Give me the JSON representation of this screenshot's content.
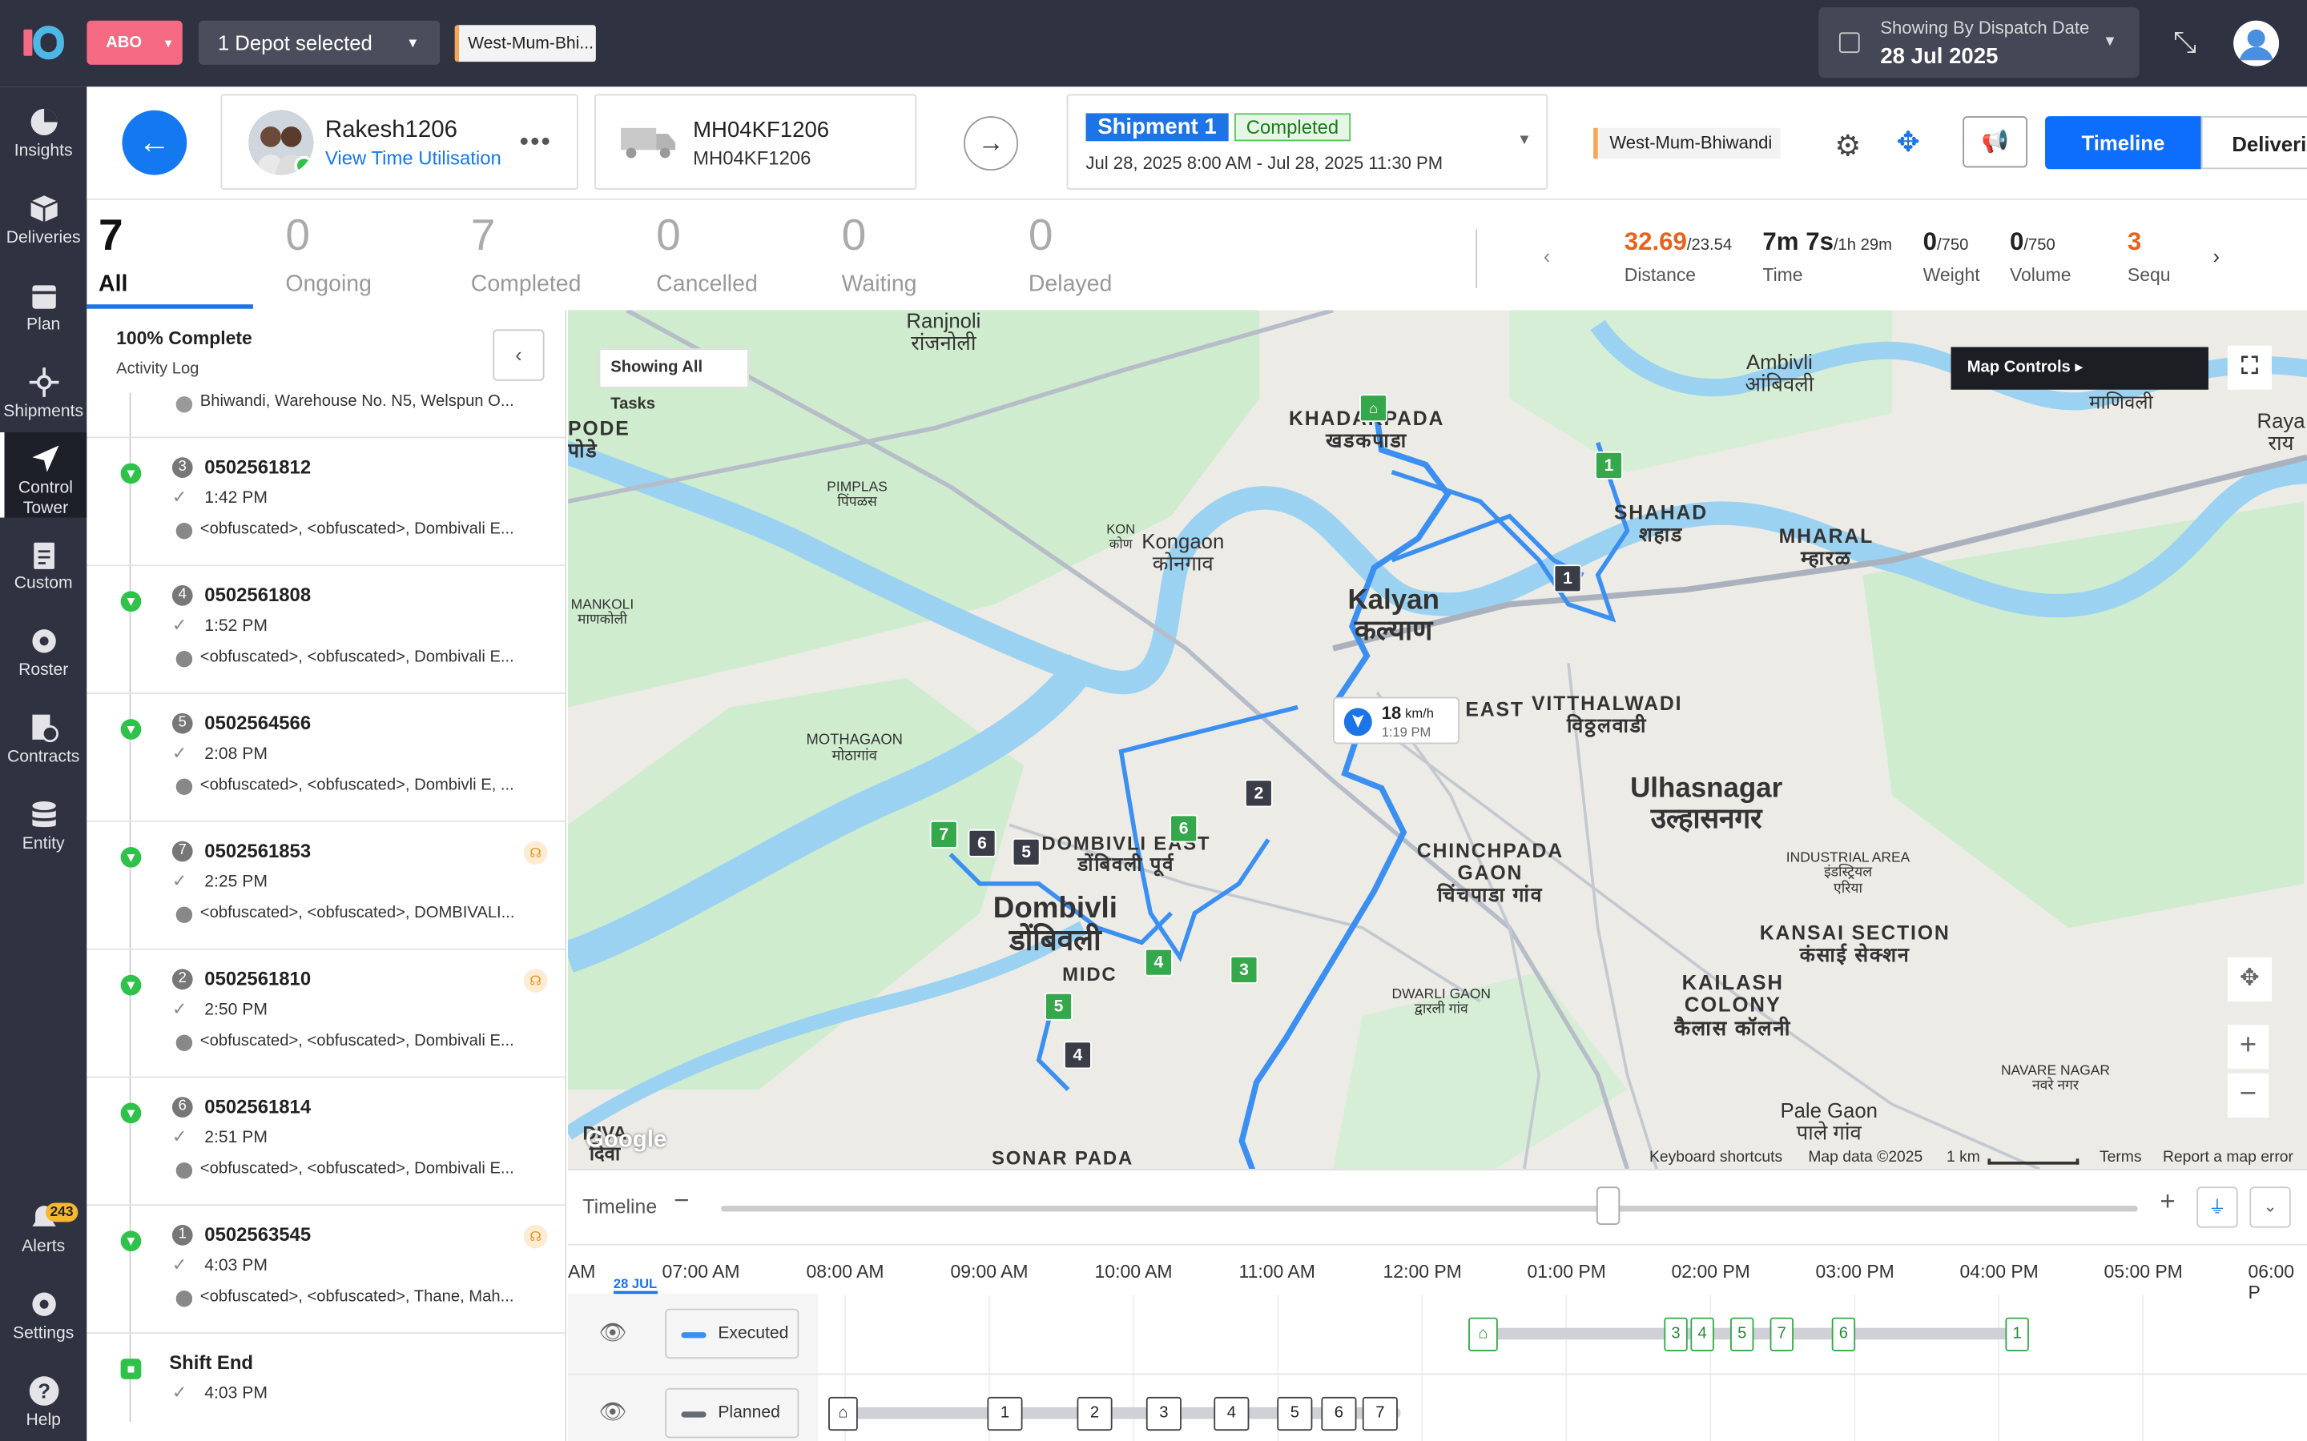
{
  "topbar": {
    "brand_color": "#f36a82",
    "tenant": "ABO",
    "depot": "1 Depot selected",
    "region_chip": "West-Mum-Bhi...",
    "dispatch_label": "Showing By Dispatch Date",
    "dispatch_date": "28 Jul 2025"
  },
  "sidebar": {
    "items": [
      {
        "label": "Insights",
        "icon": "insights-icon"
      },
      {
        "label": "Deliveries",
        "icon": "box-icon"
      },
      {
        "label": "Plan",
        "icon": "calendar-icon"
      },
      {
        "label": "Shipments",
        "icon": "hub-icon"
      },
      {
        "label": "Control Tower",
        "icon": "navigation-arrow-icon"
      },
      {
        "label": "Custom",
        "icon": "clipboard-icon"
      },
      {
        "label": "Roster",
        "icon": "gear-icon"
      },
      {
        "label": "Contracts",
        "icon": "document-clock-icon"
      },
      {
        "label": "Entity",
        "icon": "database-icon"
      },
      {
        "label": "Alerts",
        "icon": "bell-icon",
        "badge": "243"
      },
      {
        "label": "Settings",
        "icon": "gear-icon"
      },
      {
        "label": "Help",
        "icon": "help-icon"
      }
    ]
  },
  "header": {
    "driver_name": "Rakesh1206",
    "driver_link": "View Time Utilisation",
    "vehicle_number": "MH04KF1206",
    "vehicle_sub": "MH04KF1206",
    "shipment_label": "Shipment 1",
    "shipment_status": "Completed",
    "shipment_window": "Jul 28, 2025 8:00 AM - Jul 28, 2025 11:30 PM",
    "hub": "West-Mum-Bhiwandi",
    "timeline_btn": "Timeline",
    "deliveries_btn": "Deliveri"
  },
  "tabs": [
    {
      "count": "7",
      "label": "All"
    },
    {
      "count": "0",
      "label": "Ongoing"
    },
    {
      "count": "7",
      "label": "Completed"
    },
    {
      "count": "0",
      "label": "Cancelled"
    },
    {
      "count": "0",
      "label": "Waiting"
    },
    {
      "count": "0",
      "label": "Delayed"
    }
  ],
  "kpis": [
    {
      "value": "32.69",
      "total": "/23.54",
      "label": "Distance",
      "color": "#e8611d"
    },
    {
      "value": "7m 7s",
      "total": "/1h 29m",
      "label": "Time"
    },
    {
      "value": "0",
      "total": "/750",
      "label": "Weight"
    },
    {
      "value": "0",
      "total": "/750",
      "label": "Volume"
    },
    {
      "value": "3",
      "total": "",
      "label": "Sequ",
      "color": "#e8611d"
    }
  ],
  "activity": {
    "title": "100% Complete",
    "subtitle": "Activity Log",
    "first_address": "Bhiwandi, Warehouse No. N5, Welspun O...",
    "items": [
      {
        "seq": "3",
        "id": "0502561812",
        "time": "1:42 PM",
        "address": "<obfuscated>, <obfuscated>, Dombivali E...",
        "flag": false
      },
      {
        "seq": "4",
        "id": "0502561808",
        "time": "1:52 PM",
        "address": "<obfuscated>, <obfuscated>, Dombivali E...",
        "flag": false
      },
      {
        "seq": "5",
        "id": "0502564566",
        "time": "2:08 PM",
        "address": "<obfuscated>, <obfuscated>, Dombivli E, ...",
        "flag": false
      },
      {
        "seq": "7",
        "id": "0502561853",
        "time": "2:25 PM",
        "address": "<obfuscated>, <obfuscated>, DOMBIVALI...",
        "flag": true
      },
      {
        "seq": "2",
        "id": "0502561810",
        "time": "2:50 PM",
        "address": "<obfuscated>, <obfuscated>, Dombivali E...",
        "flag": true
      },
      {
        "seq": "6",
        "id": "0502561814",
        "time": "2:51 PM",
        "address": "<obfuscated>, <obfuscated>, Dombivali E...",
        "flag": false
      },
      {
        "seq": "1",
        "id": "0502563545",
        "time": "4:03 PM",
        "address": "<obfuscated>, <obfuscated>, Thane, Mah...",
        "flag": true
      }
    ],
    "end_label": "Shift End",
    "end_time": "4:03 PM"
  },
  "map": {
    "showing_all": "Showing All Tasks",
    "map_controls": "Map Controls",
    "speed": "18",
    "speed_unit": "km/h",
    "speed_time": "1:19 PM",
    "places": [
      {
        "t": "Ranjnoli\nरांजनोली"
      },
      {
        "t": "KHADAKPADA\nखडकपाडा"
      },
      {
        "t": "Ambivli\nआंबिवली"
      },
      {
        "t": "SHAHAD\nशहाड"
      },
      {
        "t": "MHARAL\nम्हारळ"
      },
      {
        "t": "Kongaon\nकोनगाव"
      },
      {
        "t": "Kalyan\nकल्याण"
      },
      {
        "t": "VITTHALWADI\nविठ्ठलवाडी"
      },
      {
        "t": "Ulhasnagar\nउल्हासनगर"
      },
      {
        "t": "Dombivli\nडोंबिवली"
      },
      {
        "t": "CHINCHPADA\nGAON\nचिंचपाडा गांव"
      },
      {
        "t": "KANSAI SECTION\nकंसाई सेक्शन"
      },
      {
        "t": "KAILASH\nCOLONY\nकैलास कॉलनी"
      },
      {
        "t": "Pale Gaon\nपाले गांव"
      },
      {
        "t": "SONAR PADA"
      },
      {
        "t": "PIMPLAS\nपिंपळस"
      },
      {
        "t": "MANKOLI\nमाणकोली"
      },
      {
        "t": "MOTHAGAON\nमोठागांव"
      },
      {
        "t": "INDUSTRIAL AREA\nइंडस्ट्रियल\nएरिया"
      },
      {
        "t": "DWARLI GAON\nद्वारली गांव"
      },
      {
        "t": "NAVARE NAGAR\nनवरे नगर"
      },
      {
        "t": "DOMBIVLI EAST\nडोंबिवली पूर्व"
      },
      {
        "t": "MIDC"
      },
      {
        "t": "DIVA\nदिवा"
      },
      {
        "t": "Raya\nराय"
      },
      {
        "t": "माणिवली"
      },
      {
        "t": "PODE\nपोडे"
      },
      {
        "t": "KON\nकोण"
      },
      {
        "t": "EAST"
      }
    ],
    "footer": [
      "Keyboard shortcuts",
      "Map data ©2025",
      "1 km",
      "Terms",
      "Report a map error"
    ],
    "google": "Google"
  },
  "timeline": {
    "label": "Timeline",
    "date_tag": "28 JUL",
    "hours": [
      "AM",
      "07:00 AM",
      "08:00 AM",
      "09:00 AM",
      "10:00 AM",
      "11:00 AM",
      "12:00 PM",
      "01:00 PM",
      "02:00 PM",
      "03:00 PM",
      "04:00 PM",
      "05:00 PM",
      "06:00 P"
    ],
    "executed_label": "Executed",
    "planned_label": "Planned",
    "executed_color": "#3b8ff0",
    "planned_color": "#666a75",
    "executed_stops": [
      "3",
      "4",
      "5",
      "7",
      "6",
      "1"
    ],
    "planned_stops": [
      "1",
      "2",
      "3",
      "4",
      "5",
      "6",
      "7"
    ]
  }
}
